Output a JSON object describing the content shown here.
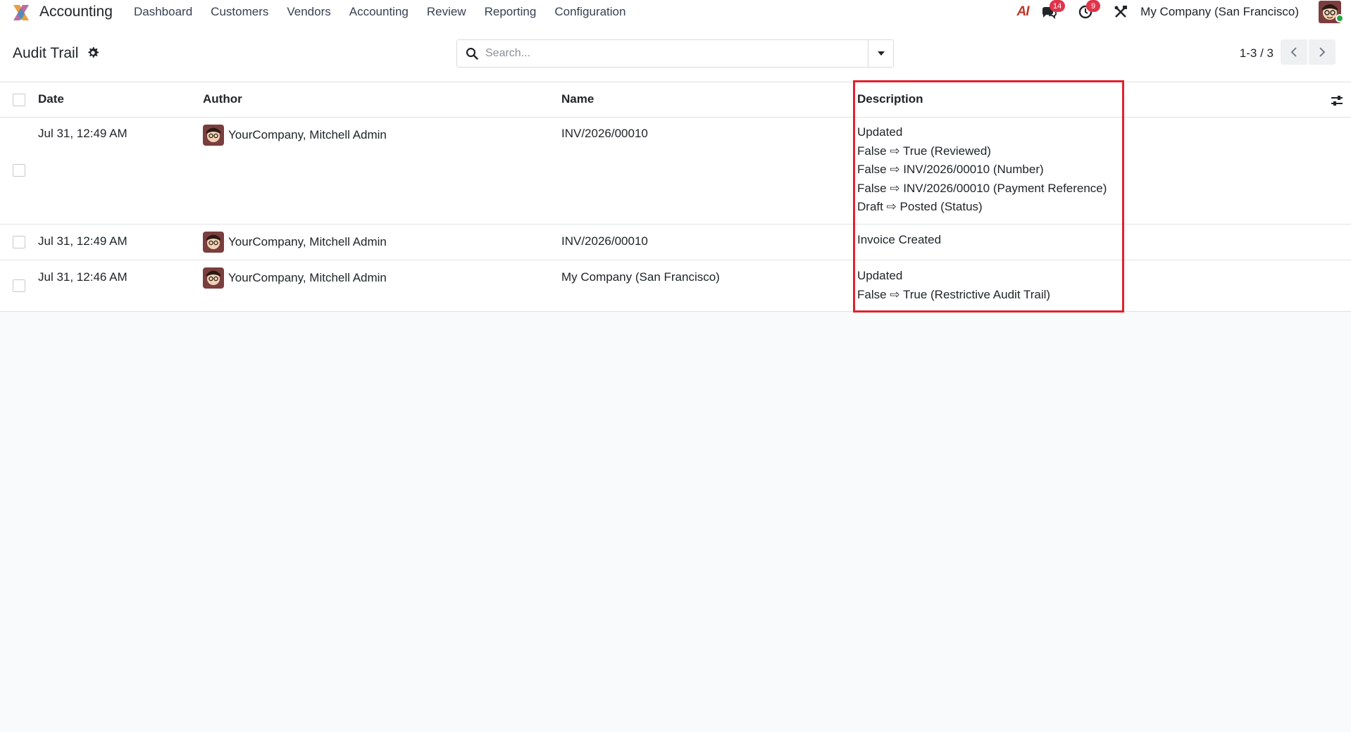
{
  "app": {
    "name": "Accounting",
    "menu": [
      "Dashboard",
      "Customers",
      "Vendors",
      "Accounting",
      "Review",
      "Reporting",
      "Configuration"
    ]
  },
  "systray": {
    "ai_label": "AI",
    "messages_count": "14",
    "activities_count": "9",
    "company": "My Company (San Francisco)"
  },
  "control_panel": {
    "title": "Audit Trail",
    "search_placeholder": "Search...",
    "pager": "1-3 / 3"
  },
  "table": {
    "columns": [
      "Date",
      "Author",
      "Name",
      "Description"
    ],
    "rows": [
      {
        "date": "Jul 31, 12:49 AM",
        "author": "YourCompany, Mitchell Admin",
        "name": "INV/2026/00010",
        "description": [
          "Updated",
          "False ⇨ True (Reviewed)",
          "False ⇨ INV/2026/00010 (Number)",
          "False ⇨ INV/2026/00010 (Payment Reference)",
          "Draft ⇨ Posted (Status)"
        ]
      },
      {
        "date": "Jul 31, 12:49 AM",
        "author": "YourCompany, Mitchell Admin",
        "name": "INV/2026/00010",
        "description": [
          "Invoice Created"
        ]
      },
      {
        "date": "Jul 31, 12:46 AM",
        "author": "YourCompany, Mitchell Admin",
        "name": "My Company (San Francisco)",
        "description": [
          "Updated",
          "False ⇨ True (Restrictive Audit Trail)"
        ]
      }
    ]
  },
  "colors": {
    "brand": "#71639e",
    "badge": "#e0344a",
    "highlight": "#e0212f",
    "online": "#28a745"
  },
  "icons": [
    "app-logo-icon",
    "ai-icon",
    "chat-icon",
    "clock-icon",
    "tools-icon",
    "gear-icon",
    "search-icon",
    "caret-down-icon",
    "chevron-left-icon",
    "chevron-right-icon",
    "optional-columns-icon"
  ]
}
